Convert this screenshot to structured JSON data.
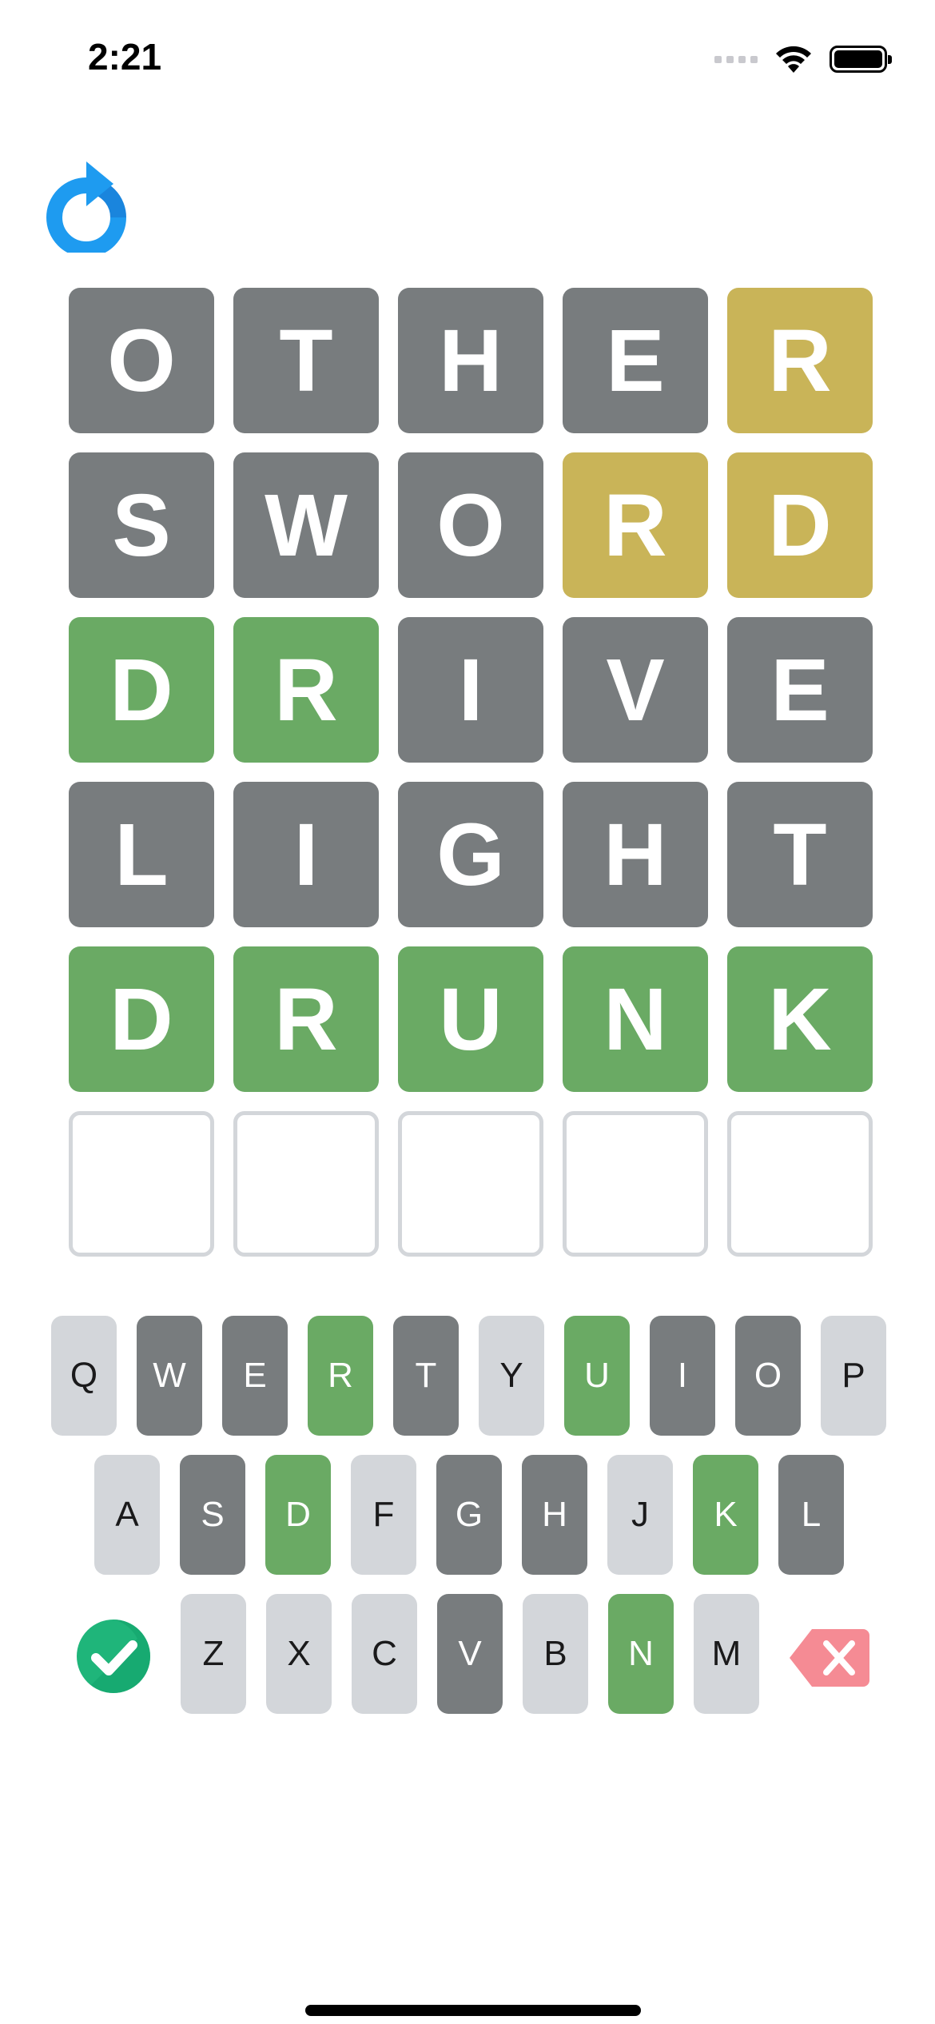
{
  "status": {
    "time": "2:21"
  },
  "grid": {
    "rows": [
      [
        {
          "letter": "O",
          "state": "gray"
        },
        {
          "letter": "T",
          "state": "gray"
        },
        {
          "letter": "H",
          "state": "gray"
        },
        {
          "letter": "E",
          "state": "gray"
        },
        {
          "letter": "R",
          "state": "yellow"
        }
      ],
      [
        {
          "letter": "S",
          "state": "gray"
        },
        {
          "letter": "W",
          "state": "gray"
        },
        {
          "letter": "O",
          "state": "gray"
        },
        {
          "letter": "R",
          "state": "yellow"
        },
        {
          "letter": "D",
          "state": "yellow"
        }
      ],
      [
        {
          "letter": "D",
          "state": "green"
        },
        {
          "letter": "R",
          "state": "green"
        },
        {
          "letter": "I",
          "state": "gray"
        },
        {
          "letter": "V",
          "state": "gray"
        },
        {
          "letter": "E",
          "state": "gray"
        }
      ],
      [
        {
          "letter": "L",
          "state": "gray"
        },
        {
          "letter": "I",
          "state": "gray"
        },
        {
          "letter": "G",
          "state": "gray"
        },
        {
          "letter": "H",
          "state": "gray"
        },
        {
          "letter": "T",
          "state": "gray"
        }
      ],
      [
        {
          "letter": "D",
          "state": "green"
        },
        {
          "letter": "R",
          "state": "green"
        },
        {
          "letter": "U",
          "state": "green"
        },
        {
          "letter": "N",
          "state": "green"
        },
        {
          "letter": "K",
          "state": "green"
        }
      ],
      [
        {
          "letter": "",
          "state": "empty"
        },
        {
          "letter": "",
          "state": "empty"
        },
        {
          "letter": "",
          "state": "empty"
        },
        {
          "letter": "",
          "state": "empty"
        },
        {
          "letter": "",
          "state": "empty"
        }
      ]
    ]
  },
  "keyboard": {
    "row1": [
      {
        "key": "Q",
        "state": "light"
      },
      {
        "key": "W",
        "state": "dark"
      },
      {
        "key": "E",
        "state": "dark"
      },
      {
        "key": "R",
        "state": "green"
      },
      {
        "key": "T",
        "state": "dark"
      },
      {
        "key": "Y",
        "state": "light"
      },
      {
        "key": "U",
        "state": "green"
      },
      {
        "key": "I",
        "state": "dark"
      },
      {
        "key": "O",
        "state": "dark"
      },
      {
        "key": "P",
        "state": "light"
      }
    ],
    "row2": [
      {
        "key": "A",
        "state": "light"
      },
      {
        "key": "S",
        "state": "dark"
      },
      {
        "key": "D",
        "state": "green"
      },
      {
        "key": "F",
        "state": "light"
      },
      {
        "key": "G",
        "state": "dark"
      },
      {
        "key": "H",
        "state": "dark"
      },
      {
        "key": "J",
        "state": "light"
      },
      {
        "key": "K",
        "state": "green"
      },
      {
        "key": "L",
        "state": "dark"
      }
    ],
    "row3": [
      {
        "key": "Z",
        "state": "light"
      },
      {
        "key": "X",
        "state": "light"
      },
      {
        "key": "C",
        "state": "light"
      },
      {
        "key": "V",
        "state": "dark"
      },
      {
        "key": "B",
        "state": "light"
      },
      {
        "key": "N",
        "state": "green"
      },
      {
        "key": "M",
        "state": "light"
      }
    ]
  },
  "icons": {
    "reset": "refresh-icon",
    "enter": "checkmark-circle-icon",
    "delete": "backspace-icon"
  },
  "colors": {
    "gray": "#787c7e",
    "yellow": "#c9b458",
    "green": "#6aaa64",
    "key_light": "#d3d6da",
    "reset_blue": "#1e9bf0",
    "enter_green": "#1fb57a",
    "delete_red": "#f58b94"
  }
}
